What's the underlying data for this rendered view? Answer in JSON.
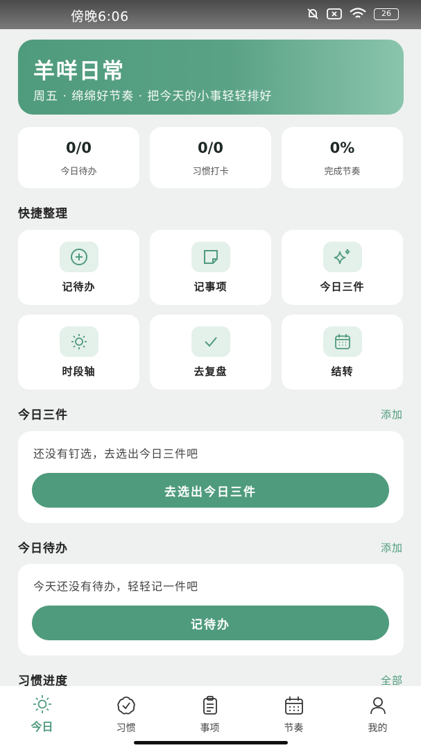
{
  "status_bar": {
    "time": "傍晚6:06",
    "battery": "26"
  },
  "header": {
    "title": "羊咩日常",
    "subtitle": "周五 · 绵绵好节奏 · 把今天的小事轻轻排好"
  },
  "stats": [
    {
      "value": "0/0",
      "label": "今日待办"
    },
    {
      "value": "0/0",
      "label": "习惯打卡"
    },
    {
      "value": "0%",
      "label": "完成节奏"
    }
  ],
  "quick": {
    "title": "快捷整理",
    "items": [
      {
        "label": "记待办",
        "icon": "plus-circle-icon"
      },
      {
        "label": "记事项",
        "icon": "note-icon"
      },
      {
        "label": "今日三件",
        "icon": "sparkle-icon"
      },
      {
        "label": "时段轴",
        "icon": "sun-icon"
      },
      {
        "label": "去复盘",
        "icon": "check-icon"
      },
      {
        "label": "结转",
        "icon": "calendar-icon"
      }
    ]
  },
  "three_things": {
    "title": "今日三件",
    "action": "添加",
    "empty_text": "还没有钉选，去选出今日三件吧",
    "button": "去选出今日三件"
  },
  "todos": {
    "title": "今日待办",
    "action": "添加",
    "empty_text": "今天还没有待办，轻轻记一件吧",
    "button": "记待办"
  },
  "habits": {
    "title": "习惯进度",
    "action": "全部"
  },
  "tabs": [
    {
      "label": "今日",
      "icon": "sun-icon",
      "active": true
    },
    {
      "label": "习惯",
      "icon": "badge-check-icon",
      "active": false
    },
    {
      "label": "事项",
      "icon": "clipboard-icon",
      "active": false
    },
    {
      "label": "节奏",
      "icon": "calendar-icon",
      "active": false
    },
    {
      "label": "我的",
      "icon": "user-icon",
      "active": false
    }
  ],
  "colors": {
    "accent": "#4f9b7d",
    "accent_light": "#e4f0ea",
    "background": "#eef1ef"
  }
}
